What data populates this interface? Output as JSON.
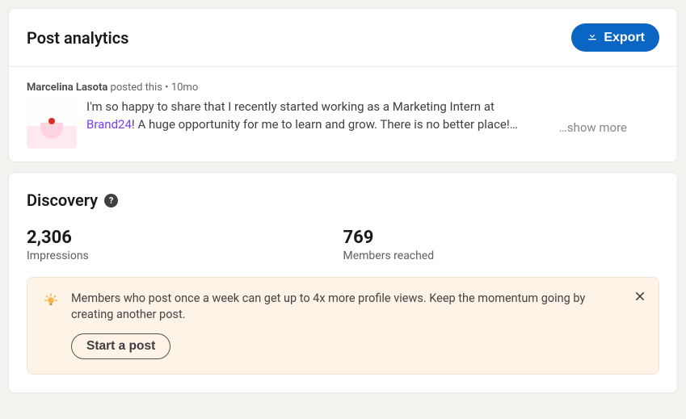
{
  "header": {
    "title": "Post analytics",
    "export_label": "Export"
  },
  "post": {
    "author": "Marcelina Lasota",
    "action_text": " posted this • ",
    "time_ago": "10mo",
    "body_before_mention": "I'm so happy to share that I recently started working as a Marketing Intern at ",
    "mention": "Brand24",
    "body_after_mention": "! A huge opportunity for me to learn and grow. There is no better place!…",
    "show_more": "…show more"
  },
  "discovery": {
    "title": "Discovery",
    "stats": [
      {
        "value": "2,306",
        "label": "Impressions"
      },
      {
        "value": "769",
        "label": "Members reached"
      }
    ],
    "tip_text": "Members who post once a week can get up to 4x more profile views. Keep the momentum going by creating another post.",
    "start_post_label": "Start a post"
  }
}
